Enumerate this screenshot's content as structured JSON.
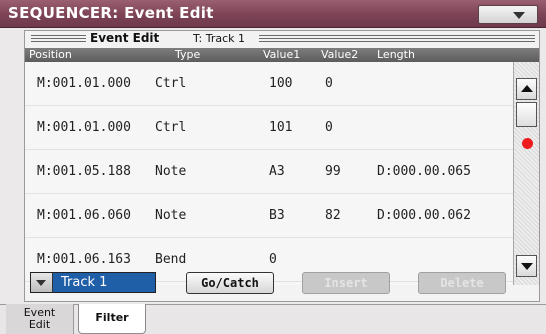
{
  "window": {
    "title": "SEQUENCER: Event Edit"
  },
  "panel": {
    "title": "Event Edit",
    "track_label": "T: Track 1"
  },
  "columns": [
    "Position",
    "Type",
    "Value1",
    "Value2",
    "Length"
  ],
  "events": [
    {
      "position": "M:001.01.000",
      "type": "Ctrl",
      "value1": "100",
      "value2": "0",
      "length": ""
    },
    {
      "position": "M:001.01.000",
      "type": "Ctrl",
      "value1": "101",
      "value2": "0",
      "length": ""
    },
    {
      "position": "M:001.05.188",
      "type": "Note",
      "value1": "A3",
      "value2": "99",
      "length": "D:000.00.065"
    },
    {
      "position": "M:001.06.060",
      "type": "Note",
      "value1": "B3",
      "value2": "82",
      "length": "D:000.00.062"
    },
    {
      "position": "M:001.06.163",
      "type": "Bend",
      "value1": "0",
      "value2": "",
      "length": ""
    }
  ],
  "controls": {
    "track_select_value": "Track 1",
    "goto_catch_label": "Go/Catch",
    "insert_label": "Insert",
    "delete_label": "Delete"
  },
  "tabs": [
    {
      "label": "Event Edit"
    },
    {
      "label": "Filter"
    }
  ],
  "icons": {
    "menu": "chevron-down-icon",
    "scroll_up": "arrow-up-icon",
    "scroll_down": "arrow-down-icon",
    "record": "record-dot-icon"
  },
  "colors": {
    "title_bar": "#7d4456",
    "selection": "#1f5fa8",
    "record_dot": "#ee1c1c"
  }
}
